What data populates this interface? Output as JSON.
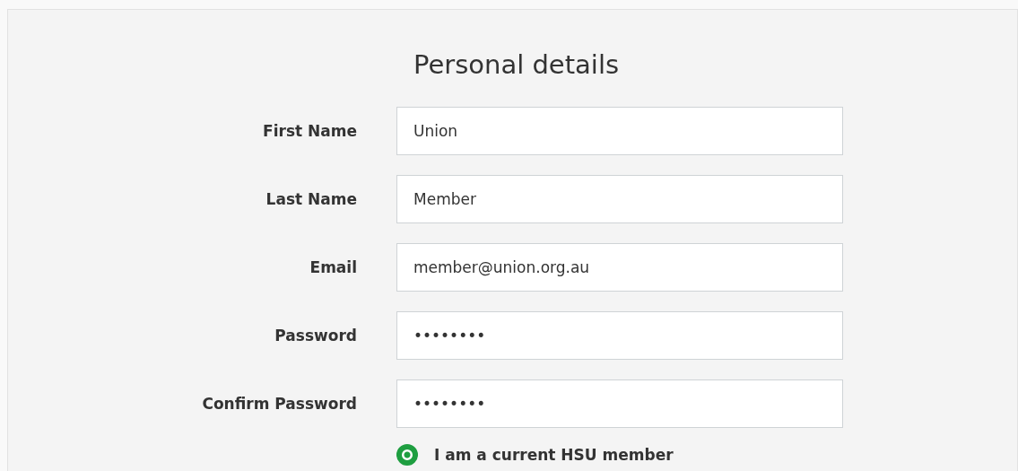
{
  "heading": "Personal details",
  "fields": [
    {
      "label": "First Name",
      "value": "Union"
    },
    {
      "label": "Last Name",
      "value": "Member"
    },
    {
      "label": "Email",
      "value": "member@union.org.au"
    },
    {
      "label": "Password",
      "value": "••••••••"
    },
    {
      "label": "Confirm Password",
      "value": "••••••••"
    }
  ],
  "options": [
    {
      "label": "I am a current HSU member",
      "selected": true
    }
  ]
}
